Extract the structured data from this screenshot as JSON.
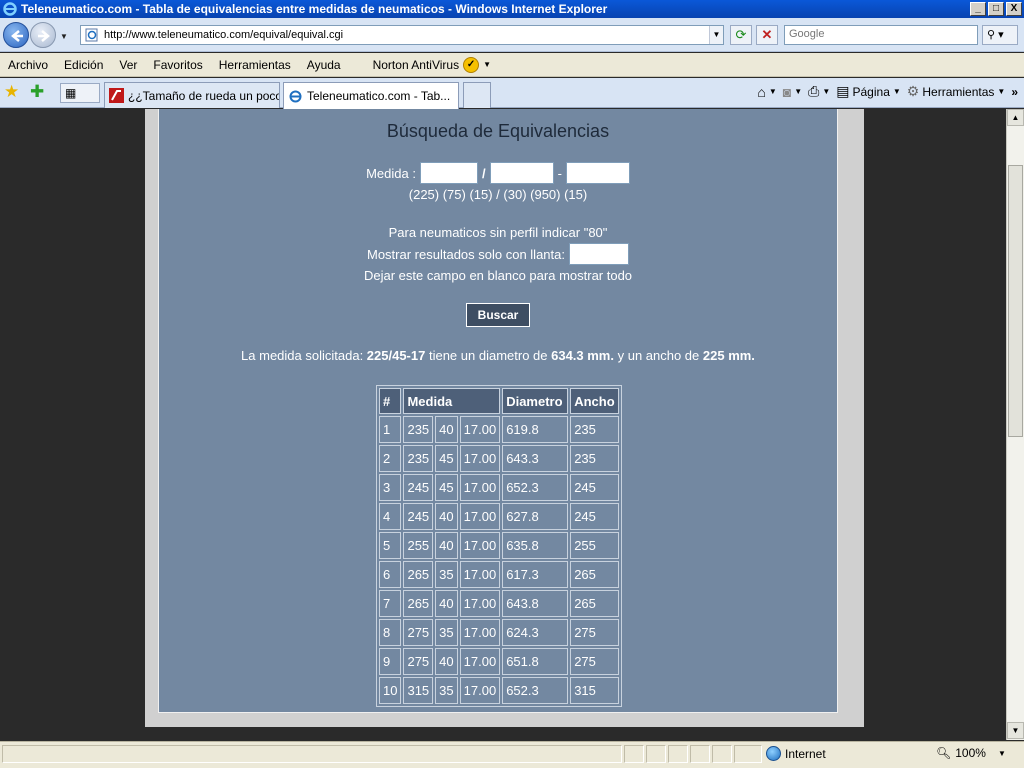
{
  "window": {
    "title": "Teleneumatico.com - Tabla de equivalencias entre medidas de neumaticos - Windows Internet Explorer",
    "min": "_",
    "max": "□",
    "close": "X"
  },
  "address_bar": {
    "url": "http://www.teleneumatico.com/equival/equival.cgi",
    "search_placeholder": "Google"
  },
  "menu": {
    "items": [
      "Archivo",
      "Edición",
      "Ver",
      "Favoritos",
      "Herramientas",
      "Ayuda"
    ],
    "norton_label": "Norton AntiVirus"
  },
  "tabs": {
    "items": [
      {
        "label": "¿¿Tamaño de rueda un poco ...",
        "active": false
      },
      {
        "label": "Teleneumatico.com - Tab...",
        "active": true
      }
    ]
  },
  "command_bar": {
    "pagina": "Página",
    "herramientas": "Herramientas"
  },
  "page": {
    "title": "Búsqueda de Equivalencias",
    "medida_label": "Medida :",
    "slash": "/",
    "dash": "-",
    "format_hint": "(225) (75) (15) / (30) (950) (15)",
    "perfil_hint": "Para neumaticos sin perfil indicar \"80\"",
    "llanta_label": "Mostrar resultados solo con llanta:",
    "blank_hint": "Dejar este campo en blanco para mostrar todo",
    "search_button": "Buscar",
    "result_prefix": "La medida solicitada: ",
    "result_size": "225/45-17",
    "result_mid": " tiene un diametro de ",
    "result_diameter": "634.3 mm.",
    "result_mid2": " y un ancho de ",
    "result_width": "225 mm."
  },
  "table": {
    "headers": [
      "#",
      "Medida",
      "Diametro",
      "Ancho"
    ],
    "rows": [
      [
        "1",
        "235",
        "40",
        "17.00",
        "619.8",
        "235"
      ],
      [
        "2",
        "235",
        "45",
        "17.00",
        "643.3",
        "235"
      ],
      [
        "3",
        "245",
        "45",
        "17.00",
        "652.3",
        "245"
      ],
      [
        "4",
        "245",
        "40",
        "17.00",
        "627.8",
        "245"
      ],
      [
        "5",
        "255",
        "40",
        "17.00",
        "635.8",
        "255"
      ],
      [
        "6",
        "265",
        "35",
        "17.00",
        "617.3",
        "265"
      ],
      [
        "7",
        "265",
        "40",
        "17.00",
        "643.8",
        "265"
      ],
      [
        "8",
        "275",
        "35",
        "17.00",
        "624.3",
        "275"
      ],
      [
        "9",
        "275",
        "40",
        "17.00",
        "651.8",
        "275"
      ],
      [
        "10",
        "315",
        "35",
        "17.00",
        "652.3",
        "315"
      ]
    ]
  },
  "status_bar": {
    "zone": "Internet",
    "zoom": "100%"
  }
}
